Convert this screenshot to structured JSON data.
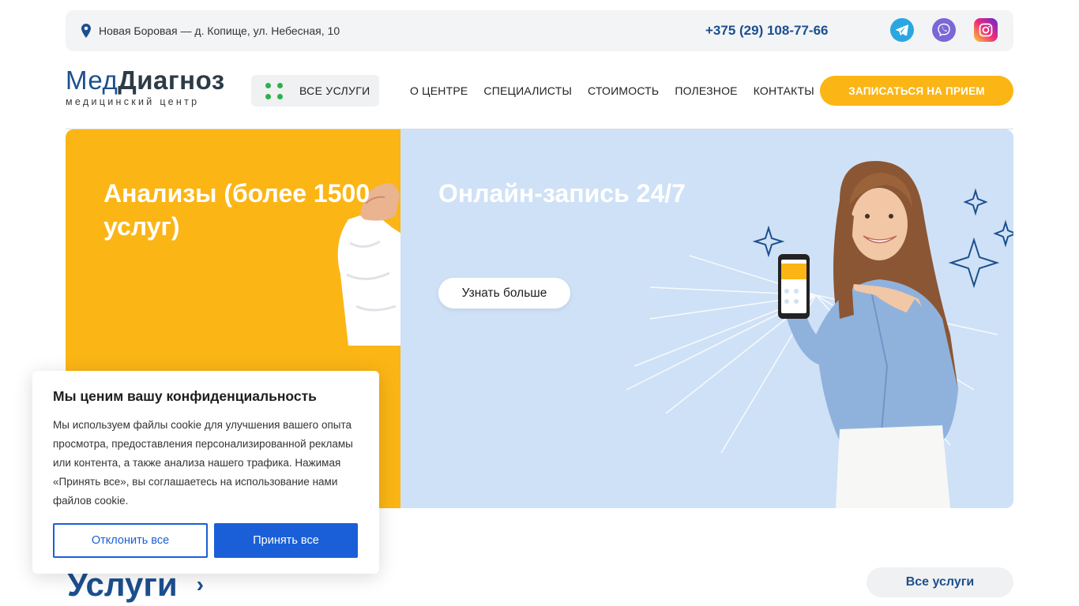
{
  "topbar": {
    "address": "Новая Боровая — д. Копище, ул. Небесная, 10",
    "phone": "+375 (29) 108-77-66",
    "social": [
      "telegram-icon",
      "viber-icon",
      "instagram-icon"
    ]
  },
  "header": {
    "logo_part1": "Мед",
    "logo_part2": "Диагноз",
    "logo_sub": "медицинский центр",
    "all_services": "ВСЕ УСЛУГИ",
    "nav": [
      "О ЦЕНТРЕ",
      "СПЕЦИАЛИСТЫ",
      "СТОИМОСТЬ",
      "ПОЛЕЗНОЕ",
      "КОНТАКТЫ"
    ],
    "cta": "ЗАПИСАТЬСЯ НА ПРИЕМ"
  },
  "banners": {
    "left_title": "Анализы (более 1500 услуг)",
    "right_title": "Онлайн-запись 24/7",
    "learn_more": "Узнать больше"
  },
  "cookie": {
    "title": "Мы ценим вашу конфиденциальность",
    "text": "Мы используем файлы cookie для улучшения вашего опыта просмотра, предоставления персонализированной рекламы или контента, а также анализа нашего трафика. Нажимая «Принять все», вы соглашаетесь на использование нами файлов cookie.",
    "decline": "Отклонить все",
    "accept": "Принять все"
  },
  "services": {
    "title": "Услуги",
    "chevron": "›",
    "all": "Все услуги"
  },
  "colors": {
    "brand_blue": "#1c4f8e",
    "accent_yellow": "#fbb515",
    "banner_blue": "#cfe1f6",
    "button_blue": "#1a5fd7"
  }
}
